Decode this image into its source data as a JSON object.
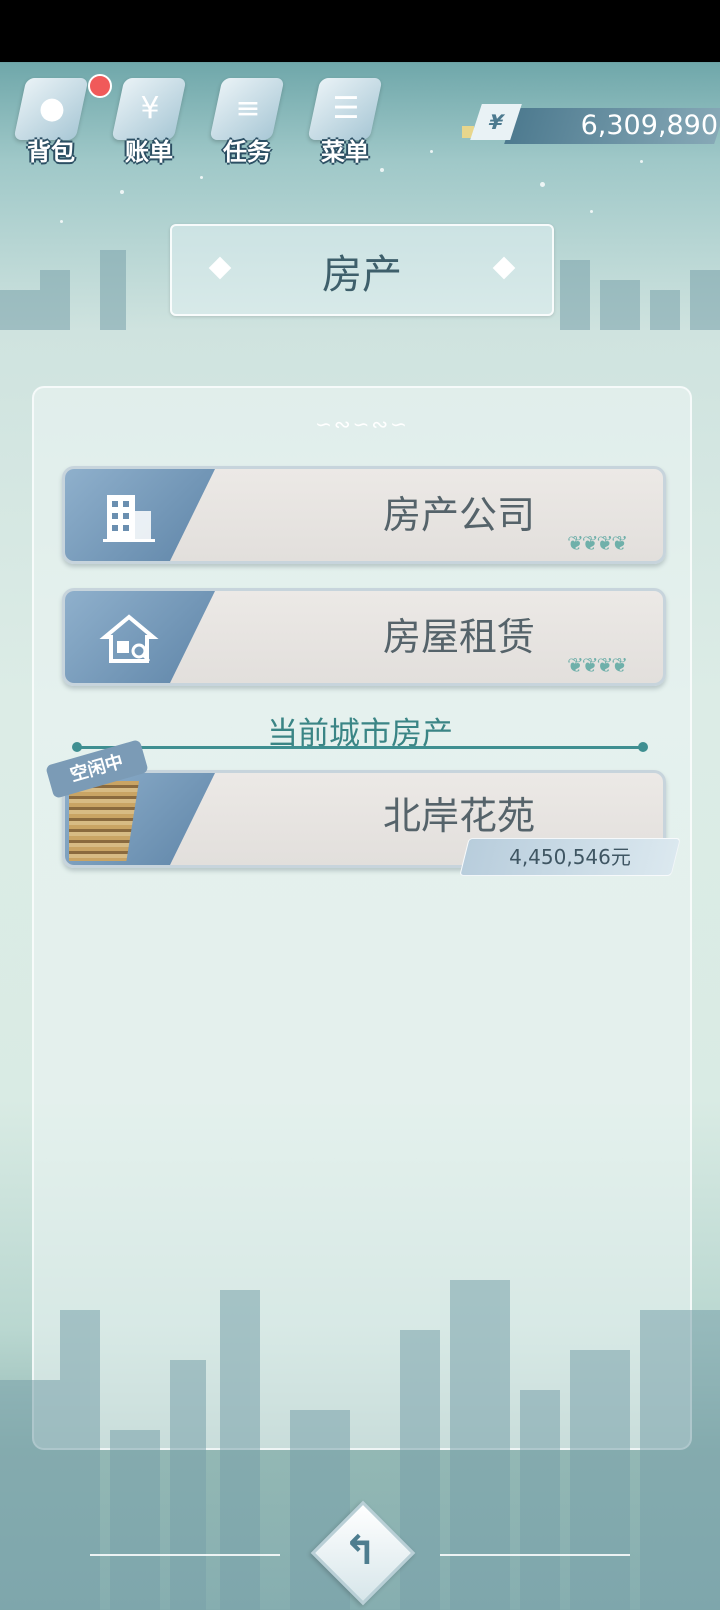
{
  "top_bar": {
    "icons": [
      {
        "label": "背包",
        "icon": "bag-icon",
        "badge": true
      },
      {
        "label": "账单",
        "icon": "bill-icon",
        "badge": false
      },
      {
        "label": "任务",
        "icon": "task-icon",
        "badge": false
      },
      {
        "label": "菜单",
        "icon": "menu-icon",
        "badge": false
      }
    ],
    "money": {
      "symbol": "¥",
      "value": "6,309,890"
    }
  },
  "title": "房产",
  "menu": [
    {
      "label": "房产公司",
      "icon": "building-icon"
    },
    {
      "label": "房屋租赁",
      "icon": "house-search-icon"
    }
  ],
  "section_title": "当前城市房产",
  "property": {
    "name": "北岸花苑",
    "status": "空闲中",
    "price": "4,450,546元"
  },
  "back_button": {
    "icon": "back-arrow-icon"
  },
  "colors": {
    "accent": "#3f8f91",
    "panel_bg": "#eaf3f2",
    "icon_blue": "#5f85a8"
  }
}
